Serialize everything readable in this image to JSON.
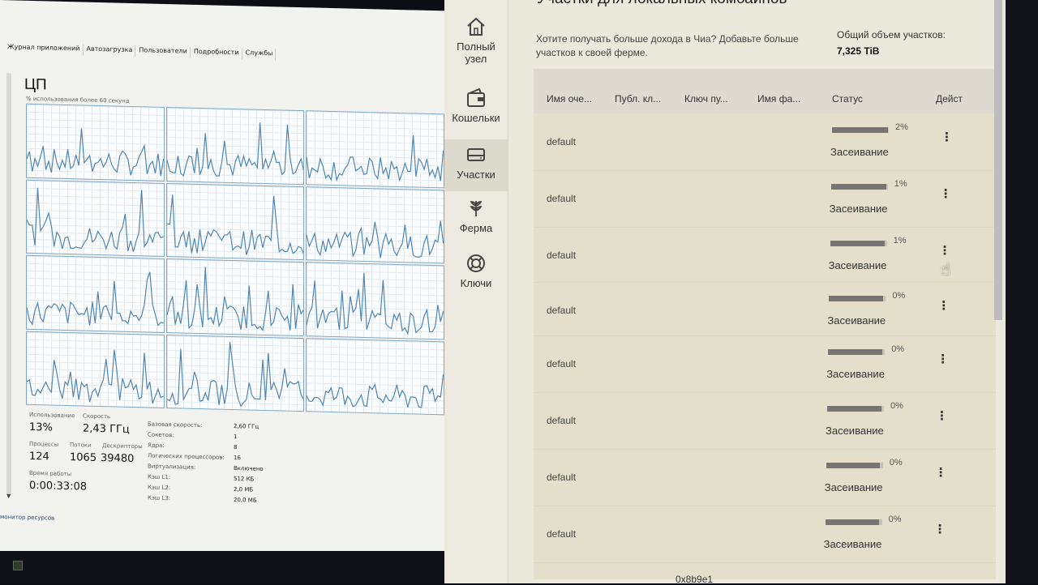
{
  "task_manager": {
    "tabs": [
      "Журнал приложений",
      "Автозагрузка",
      "Пользователи",
      "Подробности",
      "Службы"
    ],
    "title": "ЦП",
    "subtitle": "% использования более 60 секунд",
    "stats": {
      "usage_label": "Использование",
      "usage_value": "13%",
      "speed_label": "Скорость",
      "speed_value": "2,43 ГГц",
      "processes_label": "Процессы",
      "processes_value": "124",
      "threads_label": "Потоки",
      "threads_value": "1065",
      "handles_label": "Дескрипторы",
      "handles_value": "39480",
      "uptime_label": "Время работы",
      "uptime_value": "0:00:33:08"
    },
    "info": [
      {
        "label": "Базовая скорость:",
        "value": "2,60 ГГц"
      },
      {
        "label": "Сокетов:",
        "value": "1"
      },
      {
        "label": "Ядра:",
        "value": "8"
      },
      {
        "label": "Логических процессоров:",
        "value": "16"
      },
      {
        "label": "Виртуализация:",
        "value": "Включено"
      },
      {
        "label": "Кэш L1:",
        "value": "512 КБ"
      },
      {
        "label": "Кэш L2:",
        "value": "2,0 МБ"
      },
      {
        "label": "Кэш L3:",
        "value": "20,0 МБ"
      }
    ],
    "footer": "монитор ресурсов",
    "colors": {
      "graph_line": "#4f86b3",
      "graph_border": "#7fa8c4"
    }
  },
  "chia": {
    "nav": [
      {
        "label_l1": "Полный",
        "label_l2": "узел",
        "icon": "home-icon"
      },
      {
        "label_l1": "Кошельки",
        "label_l2": "",
        "icon": "wallet-icon"
      },
      {
        "label_l1": "Участки",
        "label_l2": "",
        "icon": "plots-icon"
      },
      {
        "label_l1": "Ферма",
        "label_l2": "",
        "icon": "farm-icon"
      },
      {
        "label_l1": "Ключи",
        "label_l2": "",
        "icon": "keys-icon"
      }
    ],
    "active_nav": "Участки",
    "page_title": "Участки для локальных комбайнов",
    "promo": "Хотите получать больше дохода в Чиа? Добавьте больше участков к своей ферме.",
    "total_label": "Общий объем участков:",
    "total_value": "7,325 TiB",
    "columns": [
      "Имя оче...",
      "Публ. кл...",
      "Ключ пу...",
      "Имя фа...",
      "Статус",
      "Дейст"
    ],
    "rows": [
      {
        "name": "default",
        "progress": 2,
        "progress_text": "2%",
        "status": "Засеивание"
      },
      {
        "name": "default",
        "progress": 1,
        "progress_text": "1%",
        "status": "Засеивание"
      },
      {
        "name": "default",
        "progress": 1,
        "progress_text": "1%",
        "status": "Засеивание"
      },
      {
        "name": "default",
        "progress": 0,
        "progress_text": "0%",
        "status": "Засеивание"
      },
      {
        "name": "default",
        "progress": 0,
        "progress_text": "0%",
        "status": "Засеивание"
      },
      {
        "name": "default",
        "progress": 0,
        "progress_text": "0%",
        "status": "Засеивание"
      },
      {
        "name": "default",
        "progress": 0,
        "progress_text": "0%",
        "status": "Засеивание"
      },
      {
        "name": "default",
        "progress": 0,
        "progress_text": "0%",
        "status": "Засеивание"
      }
    ],
    "bottom_text": "0x8b9e1",
    "colors": {
      "background": "#ebe8dc",
      "table_bg": "#e4dfcb",
      "progress_fill": "#757575"
    }
  }
}
